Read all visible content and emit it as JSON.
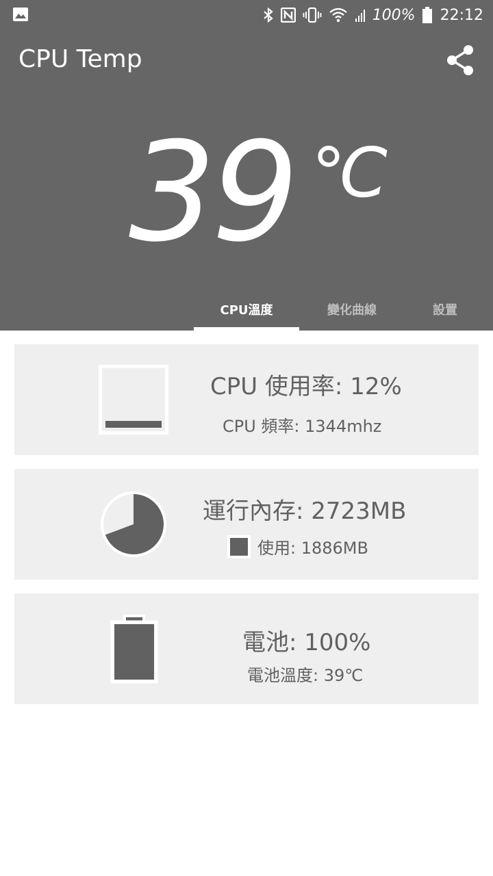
{
  "status_bar": {
    "battery_text": "100%",
    "time": "22:12"
  },
  "app_bar": {
    "title": "CPU Temp"
  },
  "temperature": {
    "value": "39",
    "unit": "℃"
  },
  "tabs": [
    {
      "label": "CPU溫度",
      "active": true
    },
    {
      "label": "變化曲線",
      "active": false
    },
    {
      "label": "設置",
      "active": false
    }
  ],
  "cards": {
    "cpu": {
      "usage_text": "CPU 使用率: 12%",
      "freq_text": "CPU 頻率: 1344mhz",
      "usage_fraction": 0.12
    },
    "memory": {
      "total_text": "運行內存: 2723MB",
      "used_text": "使用: 1886MB",
      "used_fraction": 0.6926
    },
    "battery": {
      "level_text": "電池: 100%",
      "temp_text": "電池溫度: 39℃",
      "level_fraction": 1.0
    }
  },
  "colors": {
    "header_bg": "#666666",
    "card_bg": "#efefef",
    "icon_fill": "#616161",
    "text": "#616161"
  }
}
